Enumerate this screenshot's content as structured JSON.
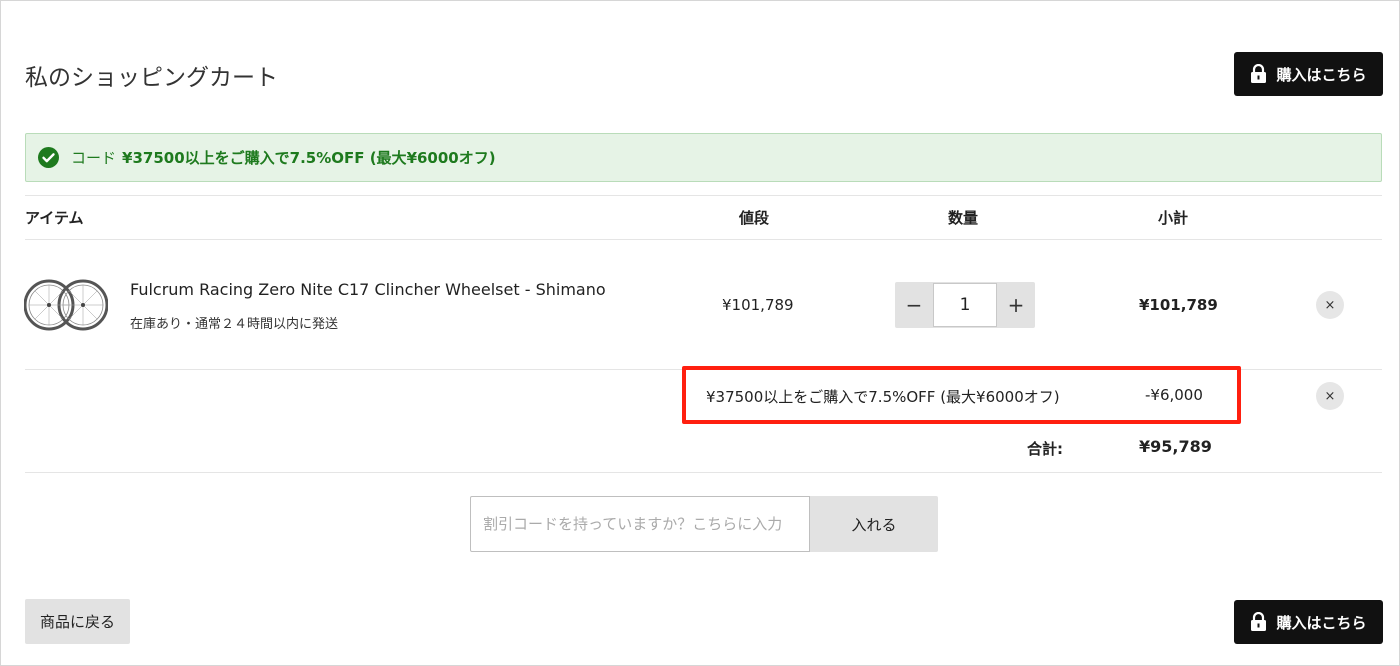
{
  "page": {
    "title": "私のショッピングカート"
  },
  "checkout": {
    "label": "購入はこちら"
  },
  "alert": {
    "code_label": "コード",
    "code_text": "¥37500以上をご購入で7.5%OFF (最大¥6000オフ)"
  },
  "table": {
    "headers": {
      "item": "アイテム",
      "price": "値段",
      "quantity": "数量",
      "subtotal": "小計"
    }
  },
  "cart_items": [
    {
      "name": "Fulcrum Racing Zero Nite C17 Clincher Wheelset - Shimano",
      "stock": "在庫あり・通常２４時間以内に発送",
      "price": "¥101,789",
      "quantity": "1",
      "subtotal": "¥101,789"
    }
  ],
  "discount": {
    "description": "¥37500以上をご購入で7.5%OFF (最大¥6000オフ)",
    "amount": "-¥6,000"
  },
  "total": {
    "label": "合計:",
    "value": "¥95,789"
  },
  "coupon": {
    "placeholder": "割引コードを持っていますか？こちらに入力",
    "button": "入れる"
  },
  "back": {
    "label": "商品に戻る"
  },
  "icons": {
    "remove": "×",
    "minus": "−",
    "plus": "+"
  },
  "colors": {
    "highlight": "#ff1f0f",
    "alert_bg": "#e6f3e6",
    "alert_text": "#1e7a1e"
  }
}
